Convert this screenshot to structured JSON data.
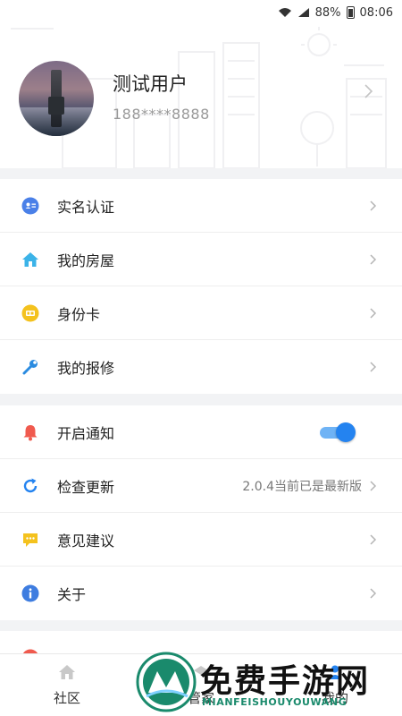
{
  "status_bar": {
    "battery": "88%",
    "time": "08:06"
  },
  "profile": {
    "name": "测试用户",
    "phone": "188****8888"
  },
  "menu_group_1": [
    {
      "label": "实名认证",
      "icon": "id-card-icon"
    },
    {
      "label": "我的房屋",
      "icon": "home-icon"
    },
    {
      "label": "身份卡",
      "icon": "card-icon"
    },
    {
      "label": "我的报修",
      "icon": "wrench-icon"
    }
  ],
  "menu_group_2": {
    "notify": {
      "label": "开启通知",
      "icon": "bell-icon",
      "enabled": true
    },
    "update": {
      "label": "检查更新",
      "icon": "refresh-icon",
      "value": "2.0.4当前已是最新版"
    },
    "feedback": {
      "label": "意见建议",
      "icon": "chat-icon"
    },
    "about": {
      "label": "关于",
      "icon": "info-icon"
    }
  },
  "tabs": [
    {
      "label": "社区",
      "icon": "home-outline-icon"
    },
    {
      "label": "管家",
      "icon": "butler-icon"
    },
    {
      "label": "我的",
      "icon": "user-icon"
    }
  ],
  "watermark": {
    "title": "免费手游网",
    "subtitle": "MIANFEISHOUYOUWANG"
  },
  "colors": {
    "accent": "#2483f0",
    "id_icon": "#4a80e8",
    "home_icon": "#3bb3e8",
    "card_icon": "#f4c21e",
    "wrench_icon": "#2a8be0",
    "bell_icon": "#f05a4e",
    "feedback_icon": "#f4c21e",
    "info_icon": "#3e7de0",
    "watermark_green": "#1a8a6c"
  }
}
